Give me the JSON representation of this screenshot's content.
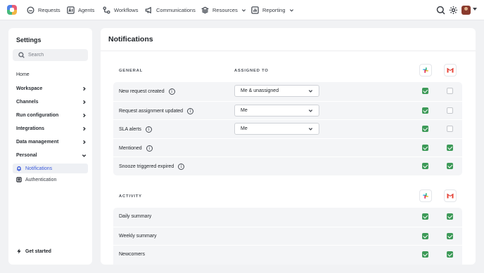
{
  "nav": {
    "items": [
      {
        "label": "Requests",
        "icon": "requests-icon"
      },
      {
        "label": "Agents",
        "icon": "agents-icon"
      },
      {
        "label": "Workflows",
        "icon": "workflows-icon"
      },
      {
        "label": "Communications",
        "icon": "megaphone-icon"
      },
      {
        "label": "Resources",
        "icon": "layers-icon"
      },
      {
        "label": "Reporting",
        "icon": "chart-icon"
      }
    ],
    "right_icons": [
      "search-icon",
      "gear-icon",
      "avatar"
    ]
  },
  "sidebar": {
    "title": "Settings",
    "search_placeholder": "Search",
    "items": [
      {
        "label": "Home"
      },
      {
        "label": "Workspace"
      },
      {
        "label": "Channels"
      },
      {
        "label": "Run configuration"
      },
      {
        "label": "Integrations"
      },
      {
        "label": "Data management"
      },
      {
        "label": "Personal"
      }
    ],
    "sub_items": [
      {
        "label": "Notifications",
        "icon": "bell-icon",
        "active": true
      },
      {
        "label": "Authentication",
        "icon": "key-icon",
        "active": false
      }
    ],
    "footer": "Get started"
  },
  "main": {
    "title": "Notifications",
    "general": {
      "label": "GENERAL",
      "assigned_label": "ASSIGNED TO",
      "rows": [
        {
          "label": "New request created",
          "assigned": "Me & unassigned",
          "slack": true,
          "gmail": false
        },
        {
          "label": "Request assignment updated",
          "assigned": "Me",
          "slack": true,
          "gmail": false
        },
        {
          "label": "SLA alerts",
          "assigned": "Me",
          "slack": true,
          "gmail": false
        },
        {
          "label": "Mentioned",
          "slack": true,
          "gmail": true
        },
        {
          "label": "Snooze triggered expired",
          "slack": true,
          "gmail": true
        }
      ]
    },
    "activity": {
      "label": "ACTIVITY",
      "rows": [
        {
          "label": "Daily summary",
          "slack": true,
          "gmail": true
        },
        {
          "label": "Weekly summary",
          "slack": true,
          "gmail": true
        },
        {
          "label": "Newcomers",
          "slack": true,
          "gmail": true
        }
      ]
    },
    "colors": {
      "checked": "#3d9a58",
      "active_nav": "#3b5bdb"
    }
  }
}
